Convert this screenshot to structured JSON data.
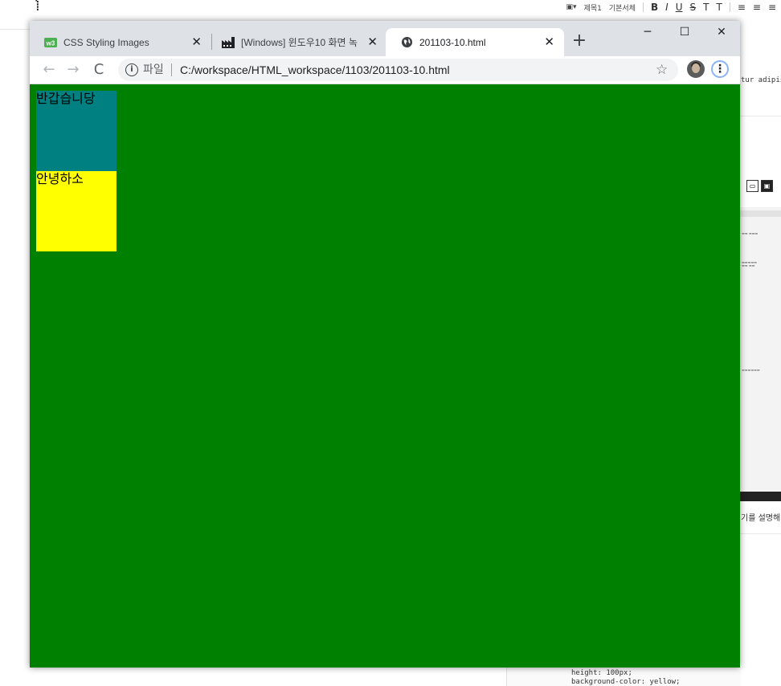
{
  "editor": {
    "toolbar": {
      "image_label": "▾",
      "heading_label": "제목1",
      "font_label": "기본서체",
      "bold": "B",
      "italic": "I",
      "underline": "U",
      "strike": "S",
      "text_color": "T",
      "text_bg": "T"
    },
    "right_text_1": "tur adipis",
    "right_text_2": "기를 설명해",
    "bottom_code_line1": "height: 100px;",
    "bottom_code_line2": "background-color: yellow;"
  },
  "browser": {
    "tabs": [
      {
        "title": "CSS Styling Images",
        "favicon": "w3schools-icon",
        "favicon_color": "#4caf50",
        "active": false
      },
      {
        "title": "[Windows] 윈도우10 화면 녹",
        "favicon": "factory-icon",
        "active": false
      },
      {
        "title": "201103-10.html",
        "favicon": "globe-icon",
        "active": true
      }
    ],
    "new_tab_label": "+",
    "window_controls": {
      "minimize": "─",
      "maximize": "☐",
      "close": "✕"
    },
    "address": {
      "scheme_label": "파일",
      "url": "C:/workspace/HTML_workspace/1103/201103-10.html"
    }
  },
  "page": {
    "background_color": "#008000",
    "boxes": [
      {
        "text": "반갑습니당",
        "color": "#008080"
      },
      {
        "text": "안녕하소",
        "color": "#ffff00"
      }
    ]
  }
}
